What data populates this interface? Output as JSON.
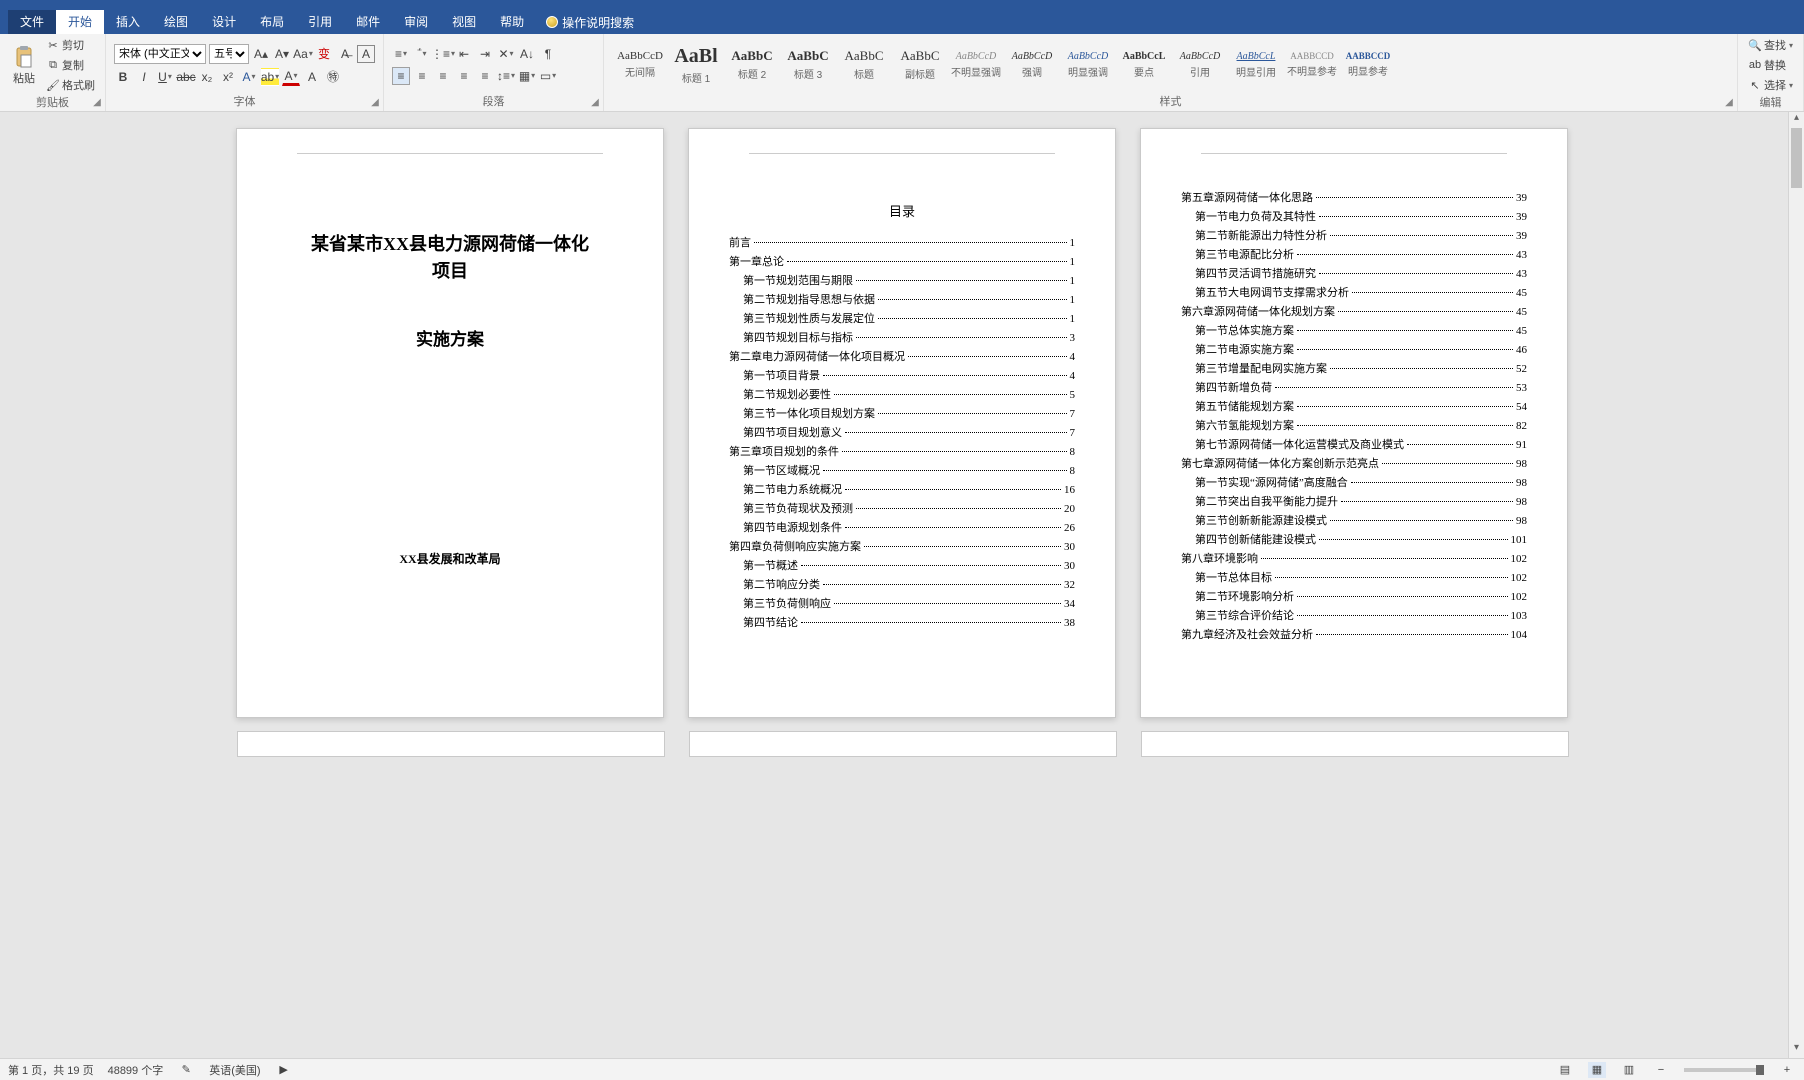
{
  "tabs": {
    "file": "文件",
    "home": "开始",
    "insert": "插入",
    "draw": "绘图",
    "design": "设计",
    "layout": "布局",
    "references": "引用",
    "mailings": "邮件",
    "review": "审阅",
    "view": "视图",
    "help": "帮助",
    "tellme": "操作说明搜索"
  },
  "ribbon": {
    "clipboard": {
      "label": "剪贴板",
      "paste": "粘贴",
      "cut": "剪切",
      "copy": "复制",
      "painter": "格式刷"
    },
    "font": {
      "label": "字体",
      "family": "宋体 (中文正文)",
      "size": "五号"
    },
    "paragraph": {
      "label": "段落"
    },
    "styles_label": "样式",
    "editing": {
      "label": "编辑",
      "find": "查找",
      "replace": "替换",
      "select": "选择"
    }
  },
  "styles": [
    {
      "prev": "AaBbCcD",
      "lbl": "无间隔",
      "size": "11px",
      "color": "#333"
    },
    {
      "prev": "AaBl",
      "lbl": "标题 1",
      "size": "20px",
      "weight": "700"
    },
    {
      "prev": "AaBbC",
      "lbl": "标题 2",
      "size": "13px",
      "weight": "700"
    },
    {
      "prev": "AaBbC",
      "lbl": "标题 3",
      "size": "13px",
      "weight": "700"
    },
    {
      "prev": "AaBbC",
      "lbl": "标题",
      "size": "13px"
    },
    {
      "prev": "AaBbC",
      "lbl": "副标题",
      "size": "13px"
    },
    {
      "prev": "AaBbCcD",
      "lbl": "不明显强调",
      "size": "10px",
      "italic": true,
      "color": "#888"
    },
    {
      "prev": "AaBbCcD",
      "lbl": "强调",
      "size": "10px",
      "italic": true
    },
    {
      "prev": "AaBbCcD",
      "lbl": "明显强调",
      "size": "10px",
      "italic": true,
      "color": "#2b579a"
    },
    {
      "prev": "AaBbCcL",
      "lbl": "要点",
      "size": "10px",
      "weight": "700"
    },
    {
      "prev": "AaBbCcD",
      "lbl": "引用",
      "size": "10px",
      "italic": true
    },
    {
      "prev": "AaBbCcL",
      "lbl": "明显引用",
      "size": "10px",
      "italic": true,
      "color": "#2b579a",
      "underline": true
    },
    {
      "prev": "AABBCCD",
      "lbl": "不明显参考",
      "size": "9px",
      "color": "#888"
    },
    {
      "prev": "AABBCCD",
      "lbl": "明显参考",
      "size": "9px",
      "color": "#2b579a",
      "weight": "700"
    }
  ],
  "page1": {
    "title": "某省某市XX县电力源网荷储一体化\n项目",
    "subtitle": "实施方案",
    "org": "XX县发展和改革局"
  },
  "toc_head": "目录",
  "toc_p2": [
    {
      "t": "前言",
      "p": "1",
      "l": 1
    },
    {
      "t": "第一章总论",
      "p": "1",
      "l": 1
    },
    {
      "t": "第一节规划范围与期限",
      "p": "1",
      "l": 2
    },
    {
      "t": "第二节规划指导思想与依据",
      "p": "1",
      "l": 2
    },
    {
      "t": "第三节规划性质与发展定位",
      "p": "1",
      "l": 2
    },
    {
      "t": "第四节规划目标与指标",
      "p": "3",
      "l": 2
    },
    {
      "t": "第二章电力源网荷储一体化项目概况",
      "p": "4",
      "l": 1
    },
    {
      "t": "第一节项目背景",
      "p": "4",
      "l": 2
    },
    {
      "t": "第二节规划必要性",
      "p": "5",
      "l": 2
    },
    {
      "t": "第三节一体化项目规划方案",
      "p": "7",
      "l": 2
    },
    {
      "t": "第四节项目规划意义",
      "p": "7",
      "l": 2
    },
    {
      "t": "第三章项目规划的条件",
      "p": "8",
      "l": 1
    },
    {
      "t": "第一节区域概况",
      "p": "8",
      "l": 2
    },
    {
      "t": "第二节电力系统概况",
      "p": "16",
      "l": 2
    },
    {
      "t": "第三节负荷现状及预测",
      "p": "20",
      "l": 2
    },
    {
      "t": "第四节电源规划条件",
      "p": "26",
      "l": 2
    },
    {
      "t": "第四章负荷侧响应实施方案",
      "p": "30",
      "l": 1
    },
    {
      "t": "第一节概述",
      "p": "30",
      "l": 2
    },
    {
      "t": "第二节响应分类",
      "p": "32",
      "l": 2
    },
    {
      "t": "第三节负荷侧响应",
      "p": "34",
      "l": 2
    },
    {
      "t": "第四节结论",
      "p": "38",
      "l": 2
    }
  ],
  "toc_p3": [
    {
      "t": "第五章源网荷储一体化思路",
      "p": "39",
      "l": 1
    },
    {
      "t": "第一节电力负荷及其特性",
      "p": "39",
      "l": 2
    },
    {
      "t": "第二节新能源出力特性分析",
      "p": "39",
      "l": 2
    },
    {
      "t": "第三节电源配比分析",
      "p": "43",
      "l": 2
    },
    {
      "t": "第四节灵活调节措施研究",
      "p": "43",
      "l": 2
    },
    {
      "t": "第五节大电网调节支撑需求分析",
      "p": "45",
      "l": 2
    },
    {
      "t": "第六章源网荷储一体化规划方案",
      "p": "45",
      "l": 1
    },
    {
      "t": "第一节总体实施方案",
      "p": "45",
      "l": 2
    },
    {
      "t": "第二节电源实施方案",
      "p": "46",
      "l": 2
    },
    {
      "t": "第三节增量配电网实施方案",
      "p": "52",
      "l": 2
    },
    {
      "t": "第四节新增负荷",
      "p": "53",
      "l": 2
    },
    {
      "t": "第五节储能规划方案",
      "p": "54",
      "l": 2
    },
    {
      "t": "第六节氢能规划方案",
      "p": "82",
      "l": 2
    },
    {
      "t": "第七节源网荷储一体化运营模式及商业模式",
      "p": "91",
      "l": 2
    },
    {
      "t": "第七章源网荷储一体化方案创新示范亮点",
      "p": "98",
      "l": 1
    },
    {
      "t": "第一节实现“源网荷储”高度融合",
      "p": "98",
      "l": 2
    },
    {
      "t": "第二节突出自我平衡能力提升",
      "p": "98",
      "l": 2
    },
    {
      "t": "第三节创新新能源建设模式",
      "p": "98",
      "l": 2
    },
    {
      "t": "第四节创新储能建设模式",
      "p": "101",
      "l": 2
    },
    {
      "t": "第八章环境影响",
      "p": "102",
      "l": 1
    },
    {
      "t": "第一节总体目标",
      "p": "102",
      "l": 2
    },
    {
      "t": "第二节环境影响分析",
      "p": "102",
      "l": 2
    },
    {
      "t": "第三节综合评价结论",
      "p": "103",
      "l": 2
    },
    {
      "t": "第九章经济及社会效益分析",
      "p": "104",
      "l": 1
    }
  ],
  "status": {
    "page": "第 1 页，共 19 页",
    "words": "48899 个字",
    "lang": "英语(美国)",
    "zoom": ""
  }
}
